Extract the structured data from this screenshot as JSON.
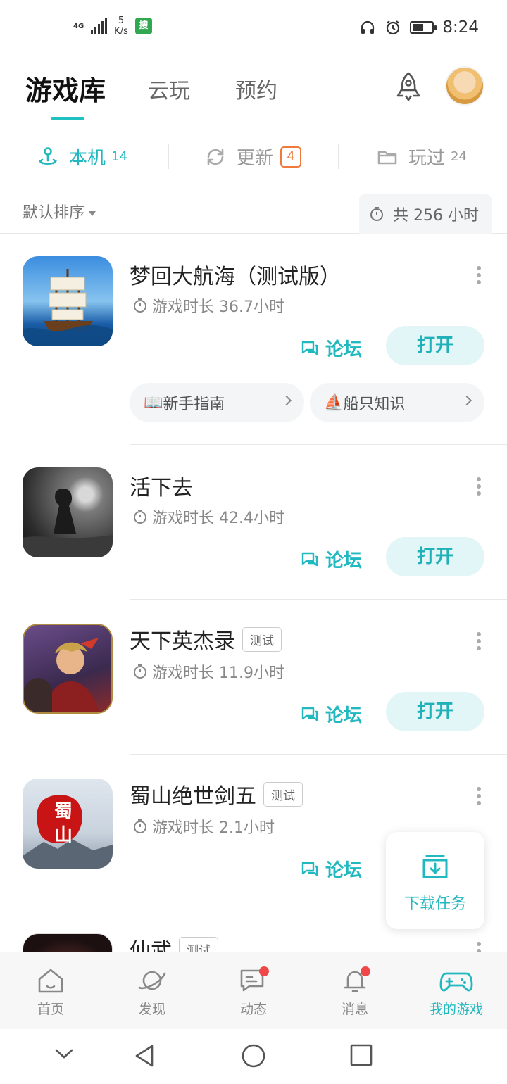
{
  "status_bar": {
    "network": "4G",
    "speed_value": "5",
    "speed_unit": "K/s",
    "app_icon_glyph": "搜",
    "time": "8:24",
    "battery_level": 0.55
  },
  "header": {
    "tabs": [
      {
        "label": "游戏库",
        "active": true
      },
      {
        "label": "云玩",
        "active": false
      },
      {
        "label": "预约",
        "active": false
      }
    ],
    "rocket_icon": "rocket-icon",
    "avatar_icon": "user-avatar"
  },
  "subtabs": [
    {
      "label": "本机",
      "count": "14",
      "icon": "local-device-icon",
      "active": true
    },
    {
      "label": "更新",
      "badge": "4",
      "icon": "refresh-icon",
      "active": false
    },
    {
      "label": "玩过",
      "count": "24",
      "icon": "folder-icon",
      "active": false
    }
  ],
  "sort": {
    "label": "默认排序",
    "total_playtime": "共 256 小时"
  },
  "games": [
    {
      "name": "梦回大航海（测试版）",
      "tag": "",
      "playtime": "游戏时长 36.7小时",
      "forum_label": "论坛",
      "open_label": "打开",
      "guides": [
        {
          "emoji": "📖",
          "label": "新手指南"
        },
        {
          "emoji": "⛵",
          "label": "船只知识"
        }
      ]
    },
    {
      "name": "活下去",
      "tag": "",
      "playtime": "游戏时长 42.4小时",
      "forum_label": "论坛",
      "open_label": "打开"
    },
    {
      "name": "天下英杰录",
      "tag": "测试",
      "playtime": "游戏时长 11.9小时",
      "forum_label": "论坛",
      "open_label": "打开"
    },
    {
      "name": "蜀山绝世剑五",
      "tag": "测试",
      "playtime": "游戏时长 2.1小时",
      "forum_label": "论坛",
      "icon_text": "蜀山"
    },
    {
      "name": "仙武",
      "tag": "测试"
    }
  ],
  "download_fab": {
    "label": "下载任务"
  },
  "bottom_nav": [
    {
      "label": "首页",
      "icon": "home-icon",
      "dot": false,
      "active": false
    },
    {
      "label": "发现",
      "icon": "planet-icon",
      "dot": false,
      "active": false
    },
    {
      "label": "动态",
      "icon": "chat-icon",
      "dot": true,
      "active": false
    },
    {
      "label": "消息",
      "icon": "bell-icon",
      "dot": true,
      "active": false
    },
    {
      "label": "我的游戏",
      "icon": "gamepad-icon",
      "dot": false,
      "active": true
    }
  ],
  "colors": {
    "accent": "#21b8c0",
    "badge": "#f07a3b",
    "notification_dot": "#f04848"
  }
}
